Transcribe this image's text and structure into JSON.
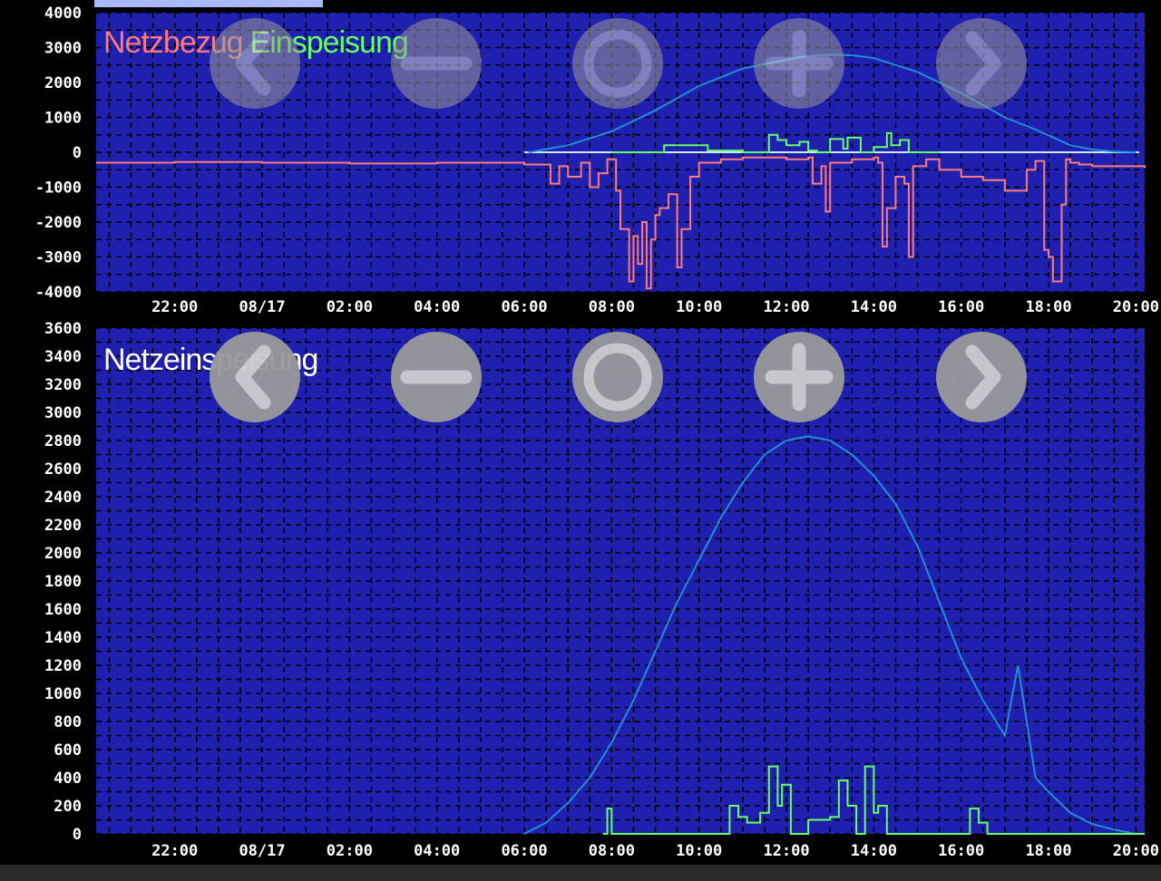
{
  "colors": {
    "background": "#000000",
    "plot_background": "#1f1fb0",
    "grid": "#000000",
    "tick_text": "#ffffff",
    "netzbezug": "#ff7a7a",
    "einspeisung": "#66ff66",
    "pv": "#1e8fd8",
    "zero_line": "#cfe8ff",
    "nav_button": "#9a9a9a",
    "nav_glyph": "#cfcfcf",
    "tab": "#a9b8ff"
  },
  "nav_buttons": [
    {
      "name": "previous-button",
      "icon": "chevron-left-icon"
    },
    {
      "name": "zoom-out-button",
      "icon": "minus-icon"
    },
    {
      "name": "reset-zoom-button",
      "icon": "circle-icon"
    },
    {
      "name": "zoom-in-button",
      "icon": "plus-icon"
    },
    {
      "name": "next-button",
      "icon": "chevron-right-icon"
    }
  ],
  "chart_data": [
    {
      "type": "line",
      "legend": [
        {
          "text": "Netzbezug",
          "color": "#ff7a7a"
        },
        {
          "text": "Einspeisung",
          "color": "#66ff66"
        }
      ],
      "x_tick_labels": [
        "22:00",
        "08/17",
        "02:00",
        "04:00",
        "06:00",
        "08:00",
        "10:00",
        "12:00",
        "14:00",
        "16:00",
        "18:00",
        "20:00"
      ],
      "x_tick_hours": [
        22,
        24,
        26,
        28,
        30,
        32,
        34,
        36,
        38,
        40,
        42,
        44
      ],
      "xlim_hours": [
        20.2,
        44.2
      ],
      "y_tick_labels": [
        "4000",
        "3000",
        "2000",
        "1000",
        "0",
        "-1000",
        "-2000",
        "-3000",
        "-4000"
      ],
      "y_ticks": [
        4000,
        3000,
        2000,
        1000,
        0,
        -1000,
        -2000,
        -3000,
        -4000
      ],
      "ylim": [
        -4000,
        4000
      ],
      "grid": true,
      "series": [
        {
          "key": "pv",
          "style": "line",
          "x": [
            30.1,
            31.0,
            32.0,
            33.0,
            34.0,
            35.0,
            36.0,
            36.5,
            37.0,
            37.5,
            38.0,
            39.0,
            40.0,
            41.0,
            41.7,
            42.5,
            43.0,
            43.5,
            44.0
          ],
          "values": [
            0,
            200,
            600,
            1200,
            1900,
            2400,
            2650,
            2760,
            2800,
            2780,
            2700,
            2300,
            1700,
            1000,
            650,
            200,
            80,
            20,
            0
          ]
        },
        {
          "key": "einspeisung",
          "style": "step",
          "x": [
            32.0,
            33.0,
            33.2,
            34.0,
            34.2,
            35.0,
            35.5,
            35.6,
            35.8,
            36.0,
            36.3,
            36.5,
            36.7,
            37.0,
            37.3,
            37.4,
            37.7,
            38.0,
            38.3,
            38.4,
            38.6,
            38.8,
            39.0,
            39.5
          ],
          "values": [
            0,
            0,
            200,
            200,
            50,
            0,
            0,
            500,
            350,
            200,
            300,
            50,
            0,
            380,
            100,
            420,
            0,
            150,
            550,
            200,
            350,
            0,
            0,
            0
          ]
        },
        {
          "key": "netzbezug",
          "style": "step",
          "x": [
            20.2,
            22.0,
            24.0,
            26.0,
            28.0,
            30.0,
            30.6,
            30.8,
            31.0,
            31.3,
            31.5,
            31.7,
            31.9,
            32.1,
            32.2,
            32.4,
            32.5,
            32.6,
            32.7,
            32.8,
            32.9,
            33.0,
            33.1,
            33.3,
            33.5,
            33.6,
            33.8,
            34.0,
            34.5,
            35.0,
            36.0,
            36.5,
            36.6,
            36.8,
            36.9,
            37.0,
            37.5,
            38.0,
            38.1,
            38.2,
            38.3,
            38.5,
            38.7,
            38.8,
            38.9,
            39.2,
            39.5,
            40.0,
            40.5,
            41.0,
            41.5,
            41.7,
            41.9,
            42.0,
            42.1,
            42.3,
            42.4,
            42.5,
            42.7,
            43.0,
            44.2
          ],
          "values": [
            -300,
            -280,
            -300,
            -320,
            -300,
            -350,
            -900,
            -400,
            -700,
            -300,
            -1000,
            -600,
            -200,
            -1100,
            -2200,
            -3700,
            -2400,
            -3200,
            -2000,
            -3900,
            -2500,
            -1800,
            -1600,
            -1200,
            -3300,
            -2200,
            -700,
            -300,
            -200,
            -150,
            -200,
            -150,
            -900,
            -400,
            -1700,
            -300,
            -200,
            -150,
            -300,
            -2700,
            -1600,
            -700,
            -900,
            -3000,
            -400,
            -200,
            -500,
            -700,
            -800,
            -1100,
            -500,
            -250,
            -2800,
            -3000,
            -3700,
            -1500,
            -200,
            -300,
            -350,
            -400,
            -450
          ]
        }
      ]
    },
    {
      "type": "line",
      "legend": [
        {
          "text": "Netzeinspeisung",
          "color": "#ffffff"
        }
      ],
      "x_tick_labels": [
        "22:00",
        "08/17",
        "02:00",
        "04:00",
        "06:00",
        "08:00",
        "10:00",
        "12:00",
        "14:00",
        "16:00",
        "18:00",
        "20:00"
      ],
      "x_tick_hours": [
        22,
        24,
        26,
        28,
        30,
        32,
        34,
        36,
        38,
        40,
        42,
        44
      ],
      "xlim_hours": [
        20.2,
        44.2
      ],
      "y_tick_labels": [
        "3600",
        "3400",
        "3200",
        "3000",
        "2800",
        "2600",
        "2400",
        "2200",
        "2000",
        "1800",
        "1600",
        "1400",
        "1200",
        "1000",
        "800",
        "600",
        "400",
        "200",
        "0"
      ],
      "y_ticks": [
        3600,
        3400,
        3200,
        3000,
        2800,
        2600,
        2400,
        2200,
        2000,
        1800,
        1600,
        1400,
        1200,
        1000,
        800,
        600,
        400,
        200,
        0
      ],
      "ylim": [
        0,
        3600
      ],
      "grid": true,
      "series": [
        {
          "key": "pv",
          "style": "line",
          "x": [
            30.0,
            30.5,
            31.0,
            31.5,
            32.0,
            32.5,
            33.0,
            33.5,
            34.0,
            34.5,
            35.0,
            35.5,
            36.0,
            36.5,
            37.0,
            37.5,
            38.0,
            38.5,
            39.0,
            39.5,
            40.0,
            40.5,
            41.0,
            41.3,
            41.5,
            41.7,
            42.0,
            42.5,
            43.0,
            43.5,
            44.0
          ],
          "values": [
            0,
            80,
            220,
            400,
            650,
            950,
            1300,
            1650,
            1950,
            2250,
            2500,
            2700,
            2800,
            2830,
            2800,
            2700,
            2550,
            2350,
            2050,
            1650,
            1250,
            950,
            700,
            1200,
            800,
            400,
            300,
            150,
            70,
            30,
            0
          ]
        },
        {
          "key": "einspeisung",
          "style": "step",
          "x": [
            31.8,
            31.9,
            32.0,
            34.5,
            34.7,
            34.9,
            35.1,
            35.4,
            35.6,
            35.8,
            35.9,
            36.1,
            36.3,
            36.5,
            37.0,
            37.2,
            37.4,
            37.6,
            37.8,
            38.0,
            38.1,
            38.3,
            38.5,
            39.0,
            40.0,
            40.2,
            40.4,
            40.6,
            44.2
          ],
          "values": [
            0,
            180,
            0,
            0,
            200,
            120,
            80,
            150,
            480,
            200,
            350,
            0,
            0,
            100,
            120,
            380,
            200,
            0,
            480,
            150,
            200,
            0,
            0,
            0,
            0,
            180,
            80,
            0,
            0
          ]
        }
      ]
    }
  ]
}
